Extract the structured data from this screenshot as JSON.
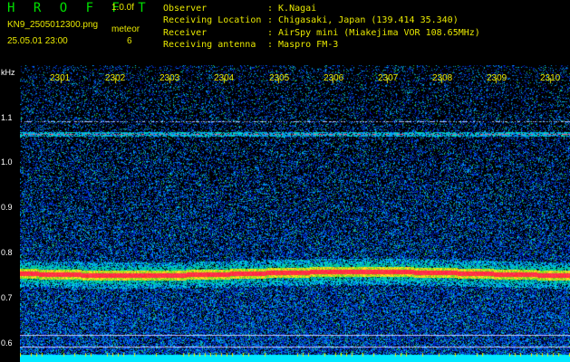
{
  "header": {
    "app_title": "H R O F F T",
    "version": "1.0.0f",
    "filename": "KN9_2505012300.png",
    "mode": "meteor",
    "datetime": "25.05.01 23:00",
    "count": "6"
  },
  "meta": [
    {
      "key": "Observer",
      "value": ": K.Nagai"
    },
    {
      "key": "Receiving Location",
      "value": ": Chigasaki, Japan (139.414 35.340)"
    },
    {
      "key": "Receiver",
      "value": ": AirSpy mini (Miakejima VOR 108.65MHz)"
    },
    {
      "key": "Receiving antenna",
      "value": ": Maspro FM-3"
    }
  ],
  "axis": {
    "unit": "kHz",
    "y_ticks": [
      "1.1",
      "1.0",
      "0.9",
      "0.8",
      "0.7",
      "0.6"
    ],
    "x_ticks": [
      "2301",
      "2302",
      "2303",
      "2304",
      "2305",
      "2306",
      "2307",
      "2308",
      "2309",
      "2310"
    ]
  },
  "colors": {
    "background": "#000000",
    "label_yellow": "#e8e800",
    "title_green": "#00e000",
    "signal_red": "#ff2020",
    "noise_blue": "#0020c0"
  }
}
